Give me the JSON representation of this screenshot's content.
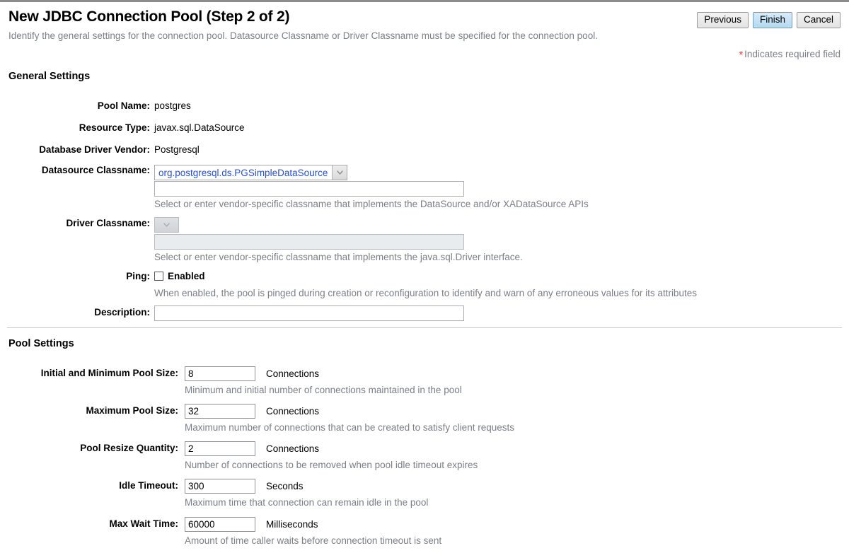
{
  "header": {
    "title": "New JDBC Connection Pool (Step 2 of 2)",
    "subtitle": "Identify the general settings for the connection pool. Datasource Classname or Driver Classname must be specified for the connection pool.",
    "required_note": "Indicates required field",
    "required_star": "*",
    "required_star_color": "#e8473f",
    "buttons": {
      "previous": "Previous",
      "finish": "Finish",
      "cancel": "Cancel"
    }
  },
  "general_settings": {
    "title": "General Settings",
    "pool_name": {
      "label": "Pool Name:",
      "value": "postgres"
    },
    "resource_type": {
      "label": "Resource Type:",
      "value": "javax.sql.DataSource"
    },
    "database_driver_vendor": {
      "label": "Database Driver Vendor:",
      "value": "Postgresql"
    },
    "datasource_classname": {
      "label": "Datasource Classname:",
      "selected": "org.postgresql.ds.PGSimpleDataSource",
      "selected_color": "#2b50c8",
      "text_value": "",
      "help": "Select or enter vendor-specific classname that implements the DataSource and/or XADataSource APIs"
    },
    "driver_classname": {
      "label": "Driver Classname:",
      "selected": "",
      "text_value": "",
      "help": "Select or enter vendor-specific classname that implements the java.sql.Driver interface."
    },
    "ping": {
      "label": "Ping:",
      "checkbox_label": "Enabled",
      "checked": false,
      "help": "When enabled, the pool is pinged during creation or reconfiguration to identify and warn of any erroneous values for its attributes"
    },
    "description": {
      "label": "Description:",
      "value": ""
    }
  },
  "pool_settings": {
    "title": "Pool Settings",
    "fields": [
      {
        "label": "Initial and Minimum Pool Size:",
        "value": "8",
        "unit": "Connections",
        "help": "Minimum and initial number of connections maintained in the pool"
      },
      {
        "label": "Maximum Pool Size:",
        "value": "32",
        "unit": "Connections",
        "help": "Maximum number of connections that can be created to satisfy client requests"
      },
      {
        "label": "Pool Resize Quantity:",
        "value": "2",
        "unit": "Connections",
        "help": "Number of connections to be removed when pool idle timeout expires"
      },
      {
        "label": "Idle Timeout:",
        "value": "300",
        "unit": "Seconds",
        "help": "Maximum time that connection can remain idle in the pool"
      },
      {
        "label": "Max Wait Time:",
        "value": "60000",
        "unit": "Milliseconds",
        "help": "Amount of time caller waits before connection timeout is sent"
      }
    ]
  },
  "icons": {
    "chevron_down": "chevron-down-icon"
  }
}
